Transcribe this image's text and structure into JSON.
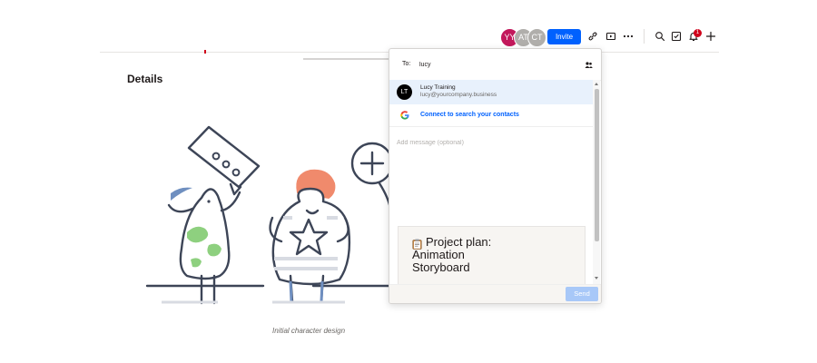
{
  "toolbar": {
    "avatars": [
      {
        "initials": "YY",
        "color": "#c2185b"
      },
      {
        "initials": "AT",
        "color": "#b0aeab"
      },
      {
        "initials": "CT",
        "color": "#b0aeab"
      }
    ],
    "invite_label": "Invite",
    "icons": [
      "link-icon",
      "present-icon",
      "more-icon",
      "search-icon",
      "checkbox-icon",
      "bell-icon",
      "plus-icon"
    ],
    "notification_count": "1",
    "accent_color": "#0061fe"
  },
  "document": {
    "heading": "Details",
    "caption": "Initial character design"
  },
  "share": {
    "to_label": "To:",
    "to_value": "lucy",
    "suggestion": {
      "initials": "LT",
      "name": "Lucy Training",
      "email": "lucy@yourcompany.business"
    },
    "google_text": "Connect to search your contacts",
    "message_placeholder": "Add message (optional)",
    "preview_title": "Project plan:\nAnimation\nStoryboard",
    "send_label": "Send"
  }
}
